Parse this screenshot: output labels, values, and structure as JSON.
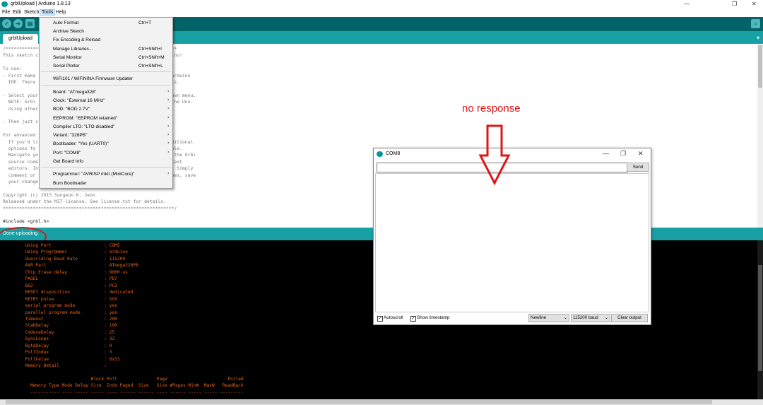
{
  "window": {
    "title": "grblUpload | Arduino 1.8.13",
    "controls": {
      "minimize": "—",
      "maximize": "❐",
      "close": "✕"
    }
  },
  "menubar": [
    "File",
    "Edit",
    "Sketch",
    "Tools",
    "Help"
  ],
  "toolbar": {
    "verify": "✓",
    "upload": "➜",
    "new": "▤",
    "open": "↑",
    "save": "↓",
    "serial_monitor": "⌕"
  },
  "tabs": [
    {
      "label": "grblUpload"
    }
  ],
  "tab_menu": "▾",
  "tools_menu": {
    "items": [
      {
        "label": "Auto Format",
        "shortcut": "Ctrl+T"
      },
      {
        "label": "Archive Sketch",
        "shortcut": ""
      },
      {
        "label": "Fix Encoding & Reload",
        "shortcut": ""
      },
      {
        "label": "Manage Libraries...",
        "shortcut": "Ctrl+Shift+I"
      },
      {
        "label": "Serial Monitor",
        "shortcut": "Ctrl+Shift+M"
      },
      {
        "label": "Serial Plotter",
        "shortcut": "Ctrl+Shift+L"
      },
      {
        "label": "WiFi101 / WiFiNINA Firmware Updater",
        "shortcut": ""
      },
      {
        "label": "Board: \"ATmega328\"",
        "submenu": true
      },
      {
        "label": "Clock: \"External 16 MHz\"",
        "submenu": true
      },
      {
        "label": "BOD: \"BOD 2.7V\"",
        "submenu": true
      },
      {
        "label": "EEPROM: \"EEPROM retained\"",
        "submenu": true
      },
      {
        "label": "Compiler LTO: \"LTO disabled\"",
        "submenu": true
      },
      {
        "label": "Variant: \"328PB\"",
        "submenu": true
      },
      {
        "label": "Bootloader: \"Yes (UART0)\"",
        "submenu": true
      },
      {
        "label": "Port: \"COM8\"",
        "submenu": true
      },
      {
        "label": "Get Board Info",
        "shortcut": ""
      },
      {
        "label": "Programmer: \"AVRISP mkII (MiniCore)\"",
        "submenu": true
      },
      {
        "label": "Burn Bootloader",
        "shortcut": ""
      }
    ],
    "arrow": "›"
  },
  "editor": {
    "lines": [
      "/***************************************************************",
      "This sketch c                                                uino!",
      "",
      "To use:",
      "- First make                                                r Arduino",
      "  IDE. There                                                this.",
      "",
      "- Select your                                               -down menu.",
      "  NOTE: Grbl                                                e the Uno.",
      "  Using other",
      "",
      "- Then just c",
      "",
      "For advanced",
      "  If you'd li                                               additional",
      "  options fo                                                sable.",
      "  Navigate yo                                               ed the Grbl",
      "  source code                                               e text",
      "  editors. Ins                                              es. Simply",
      "  comment or                                                alues, save",
      "  your change",
      "",
      "Copyright (c) 2015 Sungeun K. Jeon",
      "Released under the MIT-license. See license.txt for details.",
      "***************************************************************/",
      "",
      "#include <grbl.h>"
    ]
  },
  "status": {
    "text": "Done uploading."
  },
  "console": {
    "lines": [
      "         Using Port                    : COM5",
      "         Using Programmer              : arduino",
      "         Overriding Baud Rate          : 115200",
      "         AVR Part                      : ATmega328PB",
      "         Chip Erase delay              : 9000 us",
      "         PAGEL                         : PD7",
      "         BS2                           : PC2",
      "         RESET disposition             : dedicated",
      "         RETRY pulse                   : SCK",
      "         serial program mode           : yes",
      "         parallel program mode         : yes",
      "         Timeout                       : 200",
      "         StabDelay                     : 100",
      "         CmdexeDelay                   : 25",
      "         SyncLoops                     : 32",
      "         ByteDelay                     : 0",
      "         PollIndex                     : 3",
      "         PollValue                     : 0x53",
      "         Memory Detail                 :",
      "",
      "                                  Block Poll               Page                       Polled",
      "           Memory Type Mode Delay Size  Indx Paged  Size   Size #Pages MinW  MaxW   ReadBack",
      "           ----------- ---- ----- ----- ---- ------ ------ ---- ------ ----- ----- ---------"
    ]
  },
  "serial_monitor": {
    "title": "COM8",
    "input_value": "",
    "send_label": "Send",
    "autoscroll_label": "Autoscroll",
    "autoscroll_checked": true,
    "timestamp_label": "Show timestamp",
    "timestamp_checked": true,
    "line_ending": "Newline",
    "baud": "115200 baud",
    "clear_label": "Clear output",
    "check_glyph": "✓",
    "chevron": "⌄"
  },
  "annotation": {
    "text": "no response",
    "color": "#e01414"
  }
}
